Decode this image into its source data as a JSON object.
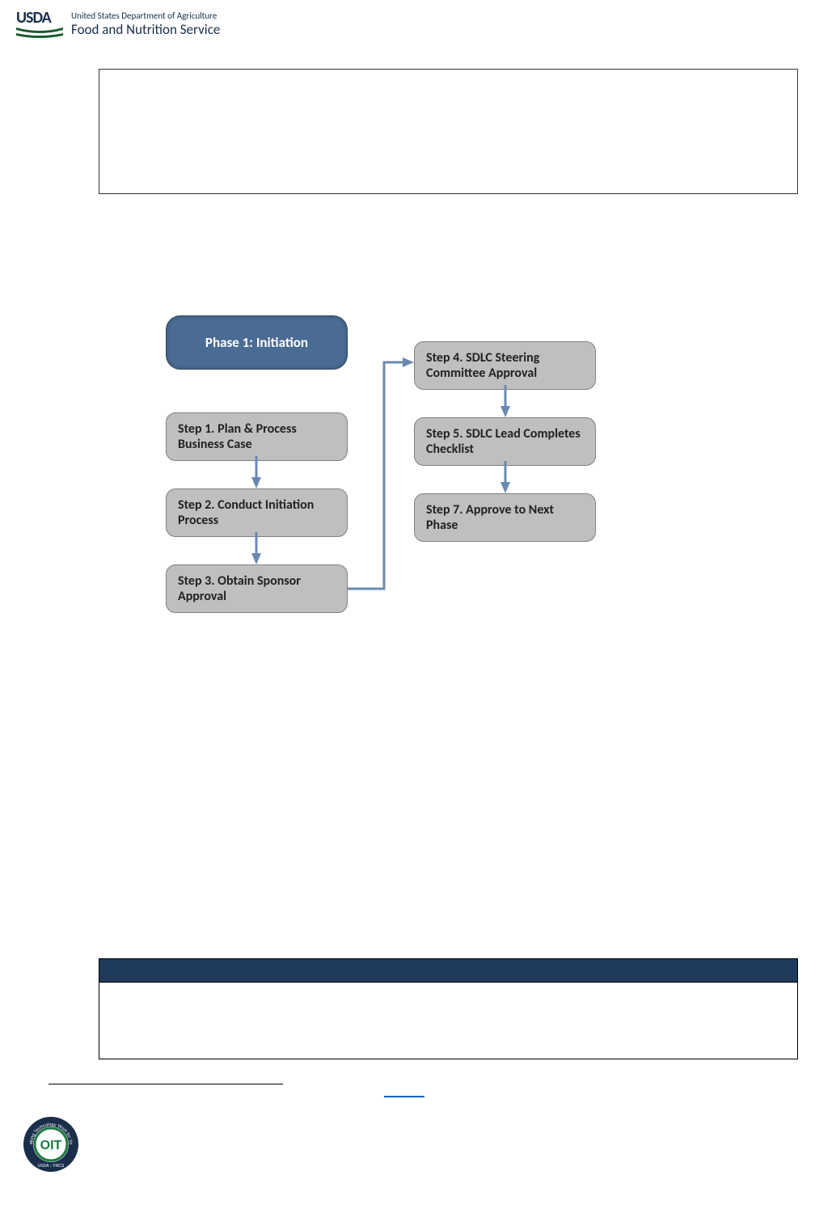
{
  "header": {
    "usda": "USDA",
    "dept": "United States Department of Agriculture",
    "fns": "Food and Nutrition Service"
  },
  "flowchart": {
    "phase": "Phase 1: Initiation",
    "step1": "Step 1. Plan & Process Business Case",
    "step2": "Step 2. Conduct Initiation Process",
    "step3": "Step 3. Obtain Sponsor Approval",
    "step4": "Step 4. SDLC Steering Committee Approval",
    "step5": "Step 5. SDLC Lead Completes Checklist",
    "step7": "Step 7. Approve to Next Phase"
  },
  "badge": {
    "center": "OIT",
    "bottom": "USDA :: FNCS",
    "ring": "Making Technology Work for You!"
  }
}
